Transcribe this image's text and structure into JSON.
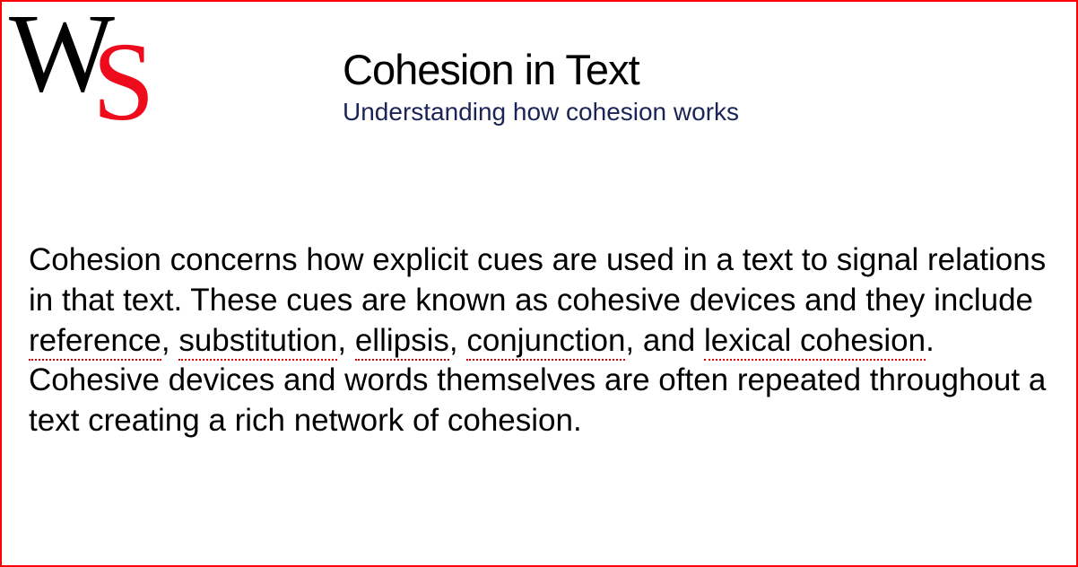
{
  "logo": {
    "letter1": "W",
    "letter2": "S"
  },
  "header": {
    "title": "Cohesion in Text",
    "subtitle": "Understanding how cohesion works"
  },
  "body": {
    "part1": "Cohesion concerns how explicit cues are used in a text to signal relations in that text. These cues are known as cohesive devices and they include ",
    "term1": "reference",
    "sep1": ", ",
    "term2": "substitution",
    "sep2": ", ",
    "term3": "ellipsis",
    "sep3": ", ",
    "term4": "conjunction",
    "sep4": ", and ",
    "term5": "lexical cohesion",
    "part2": ". Cohesive devices and words themselves are often repeated throughout a text creating a rich network of cohesion."
  }
}
